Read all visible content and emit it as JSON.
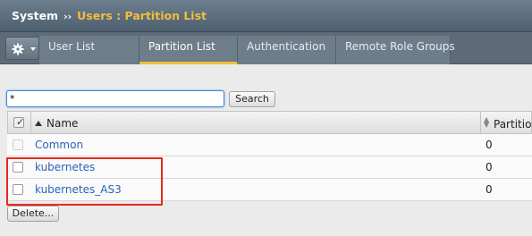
{
  "breadcrumb": {
    "section": "System",
    "separator": "››",
    "page": "Users : Partition List"
  },
  "tabs": [
    {
      "label": "User List",
      "active": false
    },
    {
      "label": "Partition List",
      "active": true
    },
    {
      "label": "Authentication",
      "active": false
    },
    {
      "label": "Remote Role Groups",
      "active": false
    }
  ],
  "search": {
    "value": "*",
    "button_label": "Search"
  },
  "table": {
    "columns": [
      "Name",
      "Partitio"
    ],
    "rows": [
      {
        "name": "Common",
        "partition_value": "0",
        "selectable": false
      },
      {
        "name": "kubernetes",
        "partition_value": "0",
        "selectable": true
      },
      {
        "name": "kubernetes_AS3",
        "partition_value": "0",
        "selectable": true
      }
    ]
  },
  "actions": {
    "delete_label": "Delete..."
  },
  "colors": {
    "accent": "#f2bf3a",
    "link": "#2a62b5",
    "highlight": "#e8291c"
  },
  "icons": [
    "gear-icon",
    "chevron-down-icon",
    "sort-ascending-icon",
    "sort-icon"
  ]
}
